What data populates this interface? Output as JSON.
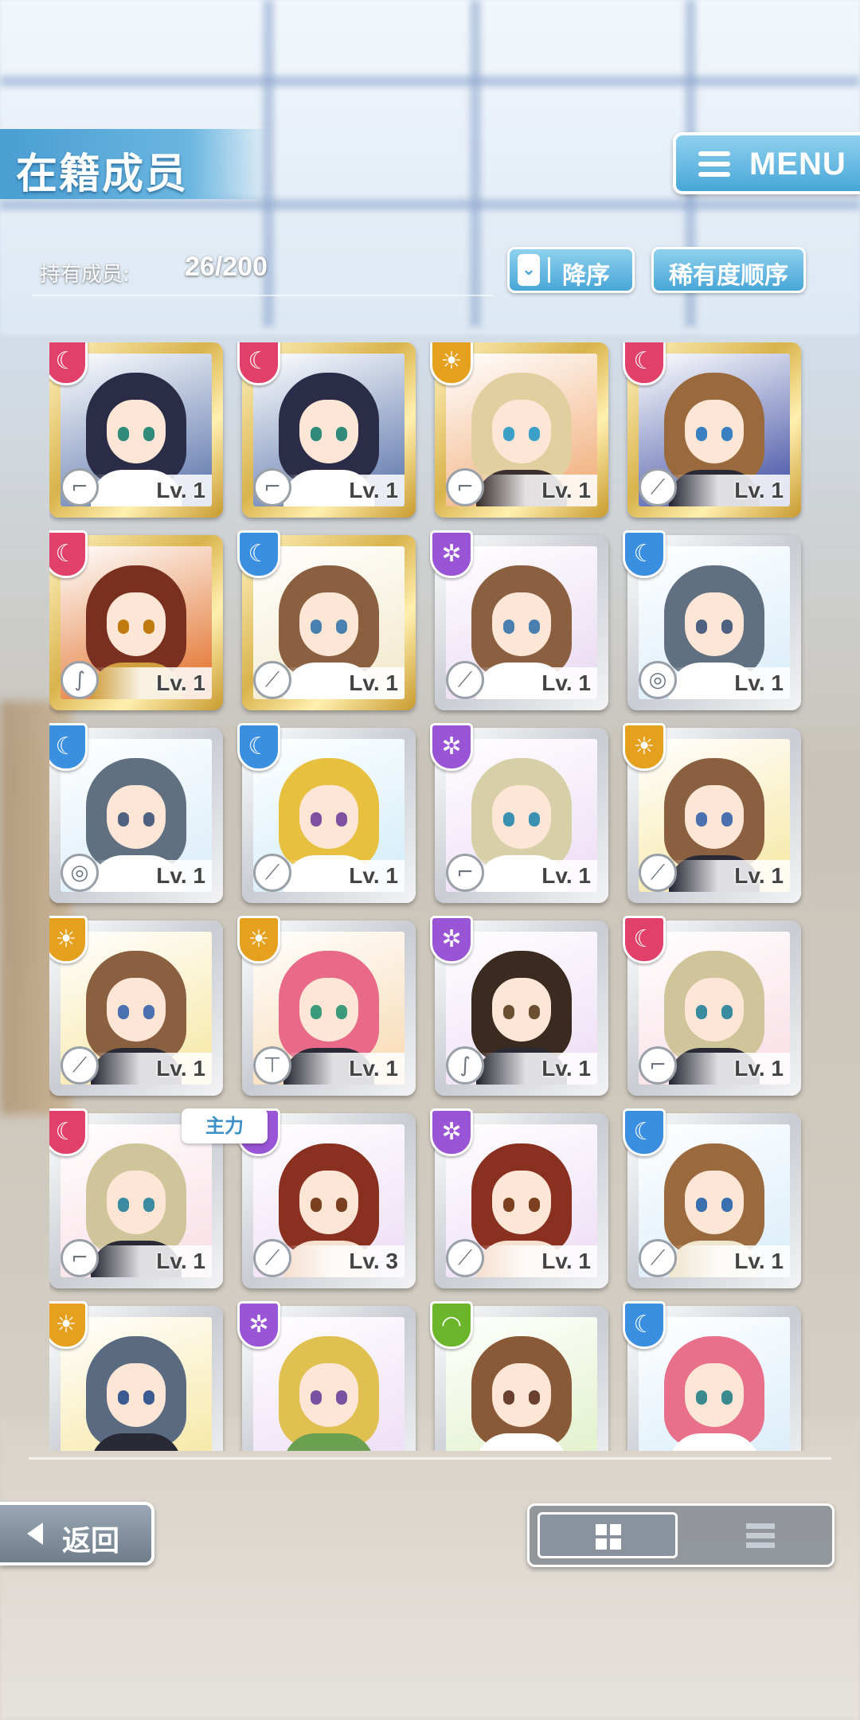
{
  "header": {
    "title": "在籍成员",
    "menu_label": "MENU"
  },
  "owned": {
    "label": "持有成员:",
    "count": "26/200"
  },
  "sort": {
    "order_label": "降序",
    "rarity_label": "稀有度顺序"
  },
  "colors": {
    "attr_red": "#e0406a",
    "attr_blue": "#3a8fe0",
    "attr_purple": "#9a55d6",
    "attr_orange": "#e5a01e",
    "attr_green": "#6bb52a",
    "accent": "#48a6d8"
  },
  "cards": [
    {
      "attr": "red",
      "type": "gun",
      "level": "Lv. 1",
      "frame": "gold",
      "hair": "#2a2c48",
      "bg": "#5570a8",
      "eye": "#2f8a7a",
      "outfit": "#ffffff"
    },
    {
      "attr": "red",
      "type": "gun",
      "level": "Lv. 1",
      "frame": "gold",
      "hair": "#2a2c48",
      "bg": "#5570a8",
      "eye": "#2f8a7a",
      "outfit": "#ffffff"
    },
    {
      "attr": "orange",
      "type": "gun",
      "level": "Lv. 1",
      "frame": "gold",
      "hair": "#e2cfa0",
      "bg": "#f0a870",
      "eye": "#3aa0c8",
      "outfit": "#3a3030"
    },
    {
      "attr": "red",
      "type": "sword",
      "level": "Lv. 1",
      "frame": "gold",
      "hair": "#9a6a3e",
      "bg": "#3a4aa0",
      "eye": "#3a80c0",
      "outfit": "#2a2a36"
    },
    {
      "attr": "red",
      "type": "whip",
      "level": "Lv. 1",
      "frame": "gold",
      "hair": "#7a3020",
      "bg": "#e06a20",
      "eye": "#c07a10",
      "outfit": "#d0a040"
    },
    {
      "attr": "blue",
      "type": "sword",
      "level": "Lv. 1",
      "frame": "gold",
      "hair": "#8a6040",
      "bg": "#f2e8c8",
      "eye": "#4a80b0",
      "outfit": "#ffffff"
    },
    {
      "attr": "purple",
      "type": "sword",
      "level": "Lv. 1",
      "frame": "silver",
      "hair": "#8a6040",
      "bg": "#e8d8f0",
      "eye": "#4a80b0",
      "outfit": "#ffffff"
    },
    {
      "attr": "blue",
      "type": "chakram",
      "level": "Lv. 1",
      "frame": "silver",
      "hair": "#607080",
      "bg": "#d8ecf8",
      "eye": "#506080",
      "outfit": "#ffffff"
    },
    {
      "attr": "blue",
      "type": "chakram",
      "level": "Lv. 1",
      "frame": "silver",
      "hair": "#607080",
      "bg": "#d8ecf8",
      "eye": "#506080",
      "outfit": "#ffffff"
    },
    {
      "attr": "blue",
      "type": "sword",
      "level": "Lv. 1",
      "frame": "silver",
      "hair": "#e8c040",
      "bg": "#d0ecf8",
      "eye": "#8050a0",
      "outfit": "#ffffff"
    },
    {
      "attr": "purple",
      "type": "gun",
      "level": "Lv. 1",
      "frame": "silver",
      "hair": "#d6cfa8",
      "bg": "#ecdcf4",
      "eye": "#3a90b0",
      "outfit": "#ffffff"
    },
    {
      "attr": "orange",
      "type": "sword",
      "level": "Lv. 1",
      "frame": "silver",
      "hair": "#8a6040",
      "bg": "#f6e6a0",
      "eye": "#4a70b0",
      "outfit": "#2a2a36"
    },
    {
      "attr": "orange",
      "type": "sword",
      "level": "Lv. 1",
      "frame": "silver",
      "hair": "#8a6040",
      "bg": "#f6e6a0",
      "eye": "#4a70b0",
      "outfit": "#2a2a36"
    },
    {
      "attr": "orange",
      "type": "hammer",
      "level": "Lv. 1",
      "frame": "silver",
      "hair": "#e86a88",
      "bg": "#f8d8b0",
      "eye": "#3a9a7a",
      "outfit": "#2a2a36"
    },
    {
      "attr": "purple",
      "type": "whip",
      "level": "Lv. 1",
      "frame": "silver",
      "hair": "#3a2a20",
      "bg": "#ecdcf4",
      "eye": "#6a5030",
      "outfit": "#2a2a36"
    },
    {
      "attr": "red",
      "type": "gun",
      "level": "Lv. 1",
      "frame": "silver",
      "hair": "#cfc49a",
      "bg": "#f8dce4",
      "eye": "#3a8aa0",
      "outfit": "#2a2a36"
    },
    {
      "attr": "red",
      "type": "gun",
      "level": "Lv. 1",
      "frame": "silver",
      "hair": "#cfc49a",
      "bg": "#f8dce4",
      "eye": "#3a8aa0",
      "outfit": "#2a2a36"
    },
    {
      "attr": "purple",
      "type": "sword",
      "level": "Lv. 3",
      "frame": "silver",
      "hair": "#8a3020",
      "bg": "#ecdcf4",
      "eye": "#7a4020",
      "outfit": "#f6e0d0"
    },
    {
      "attr": "purple",
      "type": "sword",
      "level": "Lv. 1",
      "frame": "silver",
      "hair": "#8a3020",
      "bg": "#ecdcf4",
      "eye": "#7a4020",
      "outfit": "#f6e0d0"
    },
    {
      "attr": "blue",
      "type": "sword",
      "level": "Lv. 1",
      "frame": "silver",
      "hair": "#9a6a3e",
      "bg": "#d8ecf8",
      "eye": "#3a70b0",
      "outfit": "#f0e6d0"
    },
    {
      "attr": "orange",
      "type": "gun",
      "level": "",
      "frame": "silver",
      "hair": "#5a6a80",
      "bg": "#f6e6a0",
      "eye": "#3a5a90",
      "outfit": "#2a2a36"
    },
    {
      "attr": "purple",
      "type": "gun",
      "level": "",
      "frame": "silver",
      "hair": "#e0c050",
      "bg": "#ecdcf4",
      "eye": "#7a50a0",
      "outfit": "#6aa050"
    },
    {
      "attr": "green",
      "type": "gun",
      "level": "",
      "frame": "silver",
      "hair": "#8a5a38",
      "bg": "#e0f0c8",
      "eye": "#6a4030",
      "outfit": "#ffffff"
    },
    {
      "attr": "blue",
      "type": "gun",
      "level": "",
      "frame": "silver",
      "hair": "#e8708a",
      "bg": "#d8ecf8",
      "eye": "#3a8a90",
      "outfit": "#ffffff"
    }
  ],
  "main_tag": "主力",
  "bottom": {
    "back_label": "返回"
  }
}
